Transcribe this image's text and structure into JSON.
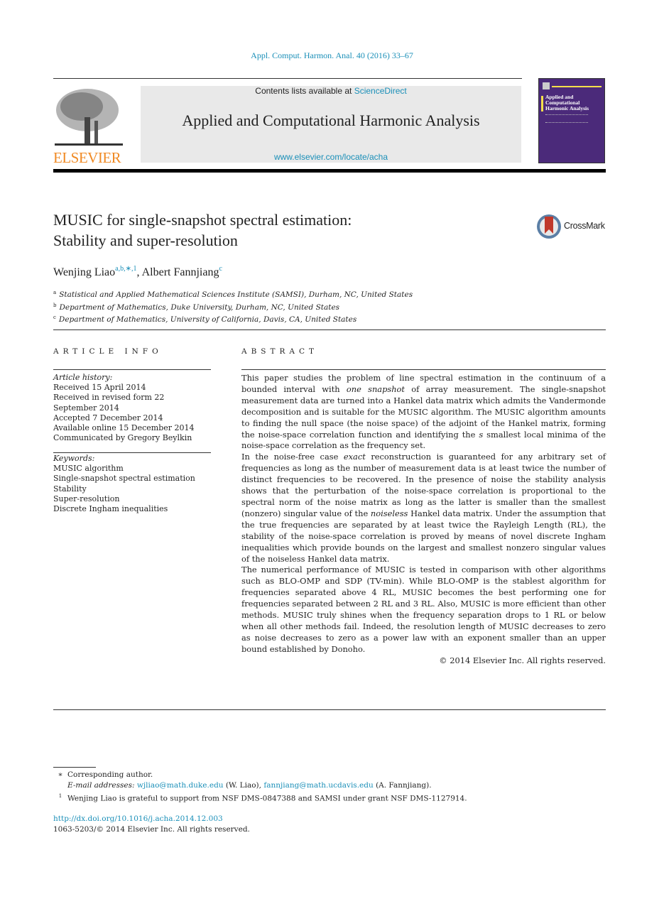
{
  "journal_ref": "Appl. Comput. Harmon. Anal. 40 (2016) 33–67",
  "header": {
    "contents_prefix": "Contents lists available at ",
    "contents_link": "ScienceDirect",
    "journal_title": "Applied and Computational Harmonic Analysis",
    "journal_url": "www.elsevier.com/locate/acha",
    "publisher_logo_text": "ELSEVIER",
    "cover_title_lines": [
      "Applied and",
      "Computational",
      "Harmonic Analysis"
    ]
  },
  "crossmark_label": "CrossMark",
  "article": {
    "title_line1": "MUSIC for single-snapshot spectral estimation:",
    "title_line2": "Stability and super-resolution",
    "authors": [
      {
        "name": "Wenjing Liao",
        "marks": "a,b,∗,1"
      },
      {
        "name": "Albert Fannjiang",
        "marks": "c"
      }
    ],
    "author_sep": ", ",
    "affiliations": [
      {
        "mark": "a",
        "text": "Statistical and Applied Mathematical Sciences Institute (SAMSI), Durham, NC, United States"
      },
      {
        "mark": "b",
        "text": "Department of Mathematics, Duke University, Durham, NC, United States"
      },
      {
        "mark": "c",
        "text": "Department of Mathematics, University of California, Davis, CA, United States"
      }
    ]
  },
  "article_info": {
    "heading": "ARTICLE INFO",
    "history_label": "Article history:",
    "history": [
      "Received 15 April 2014",
      "Received in revised form 22",
      "September 2014",
      "Accepted 7 December 2014",
      "Available online 15 December 2014",
      "Communicated by Gregory Beylkin"
    ],
    "keywords_label": "Keywords:",
    "keywords": [
      "MUSIC algorithm",
      "Single-snapshot spectral estimation",
      "Stability",
      "Super-resolution",
      "Discrete Ingham inequalities"
    ]
  },
  "abstract": {
    "heading": "ABSTRACT",
    "p1_a": "This paper studies the problem of line spectral estimation in the continuum of a bounded interval with ",
    "p1_em": "one snapshot",
    "p1_b": " of array measurement. The single-snapshot measurement data are turned into a Hankel data matrix which admits the Vandermonde decomposition and is suitable for the MUSIC algorithm. The MUSIC algorithm amounts to finding the null space (the noise space) of the adjoint of the Hankel matrix, forming the noise-space correlation function and identifying the ",
    "p1_var": "s",
    "p1_c": " smallest local minima of the noise-space correlation as the frequency set.",
    "p2_a": "In the noise-free case ",
    "p2_em1": "exact",
    "p2_b": " reconstruction is guaranteed for any arbitrary set of frequencies as long as the number of measurement data is at least twice the number of distinct frequencies to be recovered. In the presence of noise the stability analysis shows that the perturbation of the noise-space correlation is proportional to the spectral norm of the noise matrix as long as the latter is smaller than the smallest (nonzero) singular value of the ",
    "p2_em2": "noiseless",
    "p2_c": " Hankel data matrix. Under the assumption that the true frequencies are separated by at least twice the Rayleigh Length (RL), the stability of the noise-space correlation is proved by means of novel discrete Ingham inequalities which provide bounds on the largest and smallest nonzero singular values of the noiseless Hankel data matrix.",
    "p3": "The numerical performance of MUSIC is tested in comparison with other algorithms such as BLO-OMP and SDP (TV-min). While BLO-OMP is the stablest algorithm for frequencies separated above 4 RL, MUSIC becomes the best performing one for frequencies separated between 2 RL and 3 RL. Also, MUSIC is more efficient than other methods. MUSIC truly shines when the frequency separation drops to 1 RL or below when all other methods fail. Indeed, the resolution length of MUSIC decreases to zero as noise decreases to zero as a power law with an exponent smaller than an upper bound established by Donoho.",
    "copyright": "© 2014 Elsevier Inc. All rights reserved."
  },
  "footnotes": {
    "star_mark": "∗",
    "corresponding": "Corresponding author.",
    "email_label": "E-mail addresses:",
    "email1": "wjliao@math.duke.edu",
    "email1_who": " (W. Liao), ",
    "email2": "fannjiang@math.ucdavis.edu",
    "email2_who": " (A. Fannjiang).",
    "one_mark": "1",
    "support": "Wenjing Liao is grateful to support from NSF DMS-0847388 and SAMSI under grant NSF DMS-1127914."
  },
  "doi": "http://dx.doi.org/10.1016/j.acha.2014.12.003",
  "issn_line": "1063-5203/© 2014 Elsevier Inc. All rights reserved."
}
